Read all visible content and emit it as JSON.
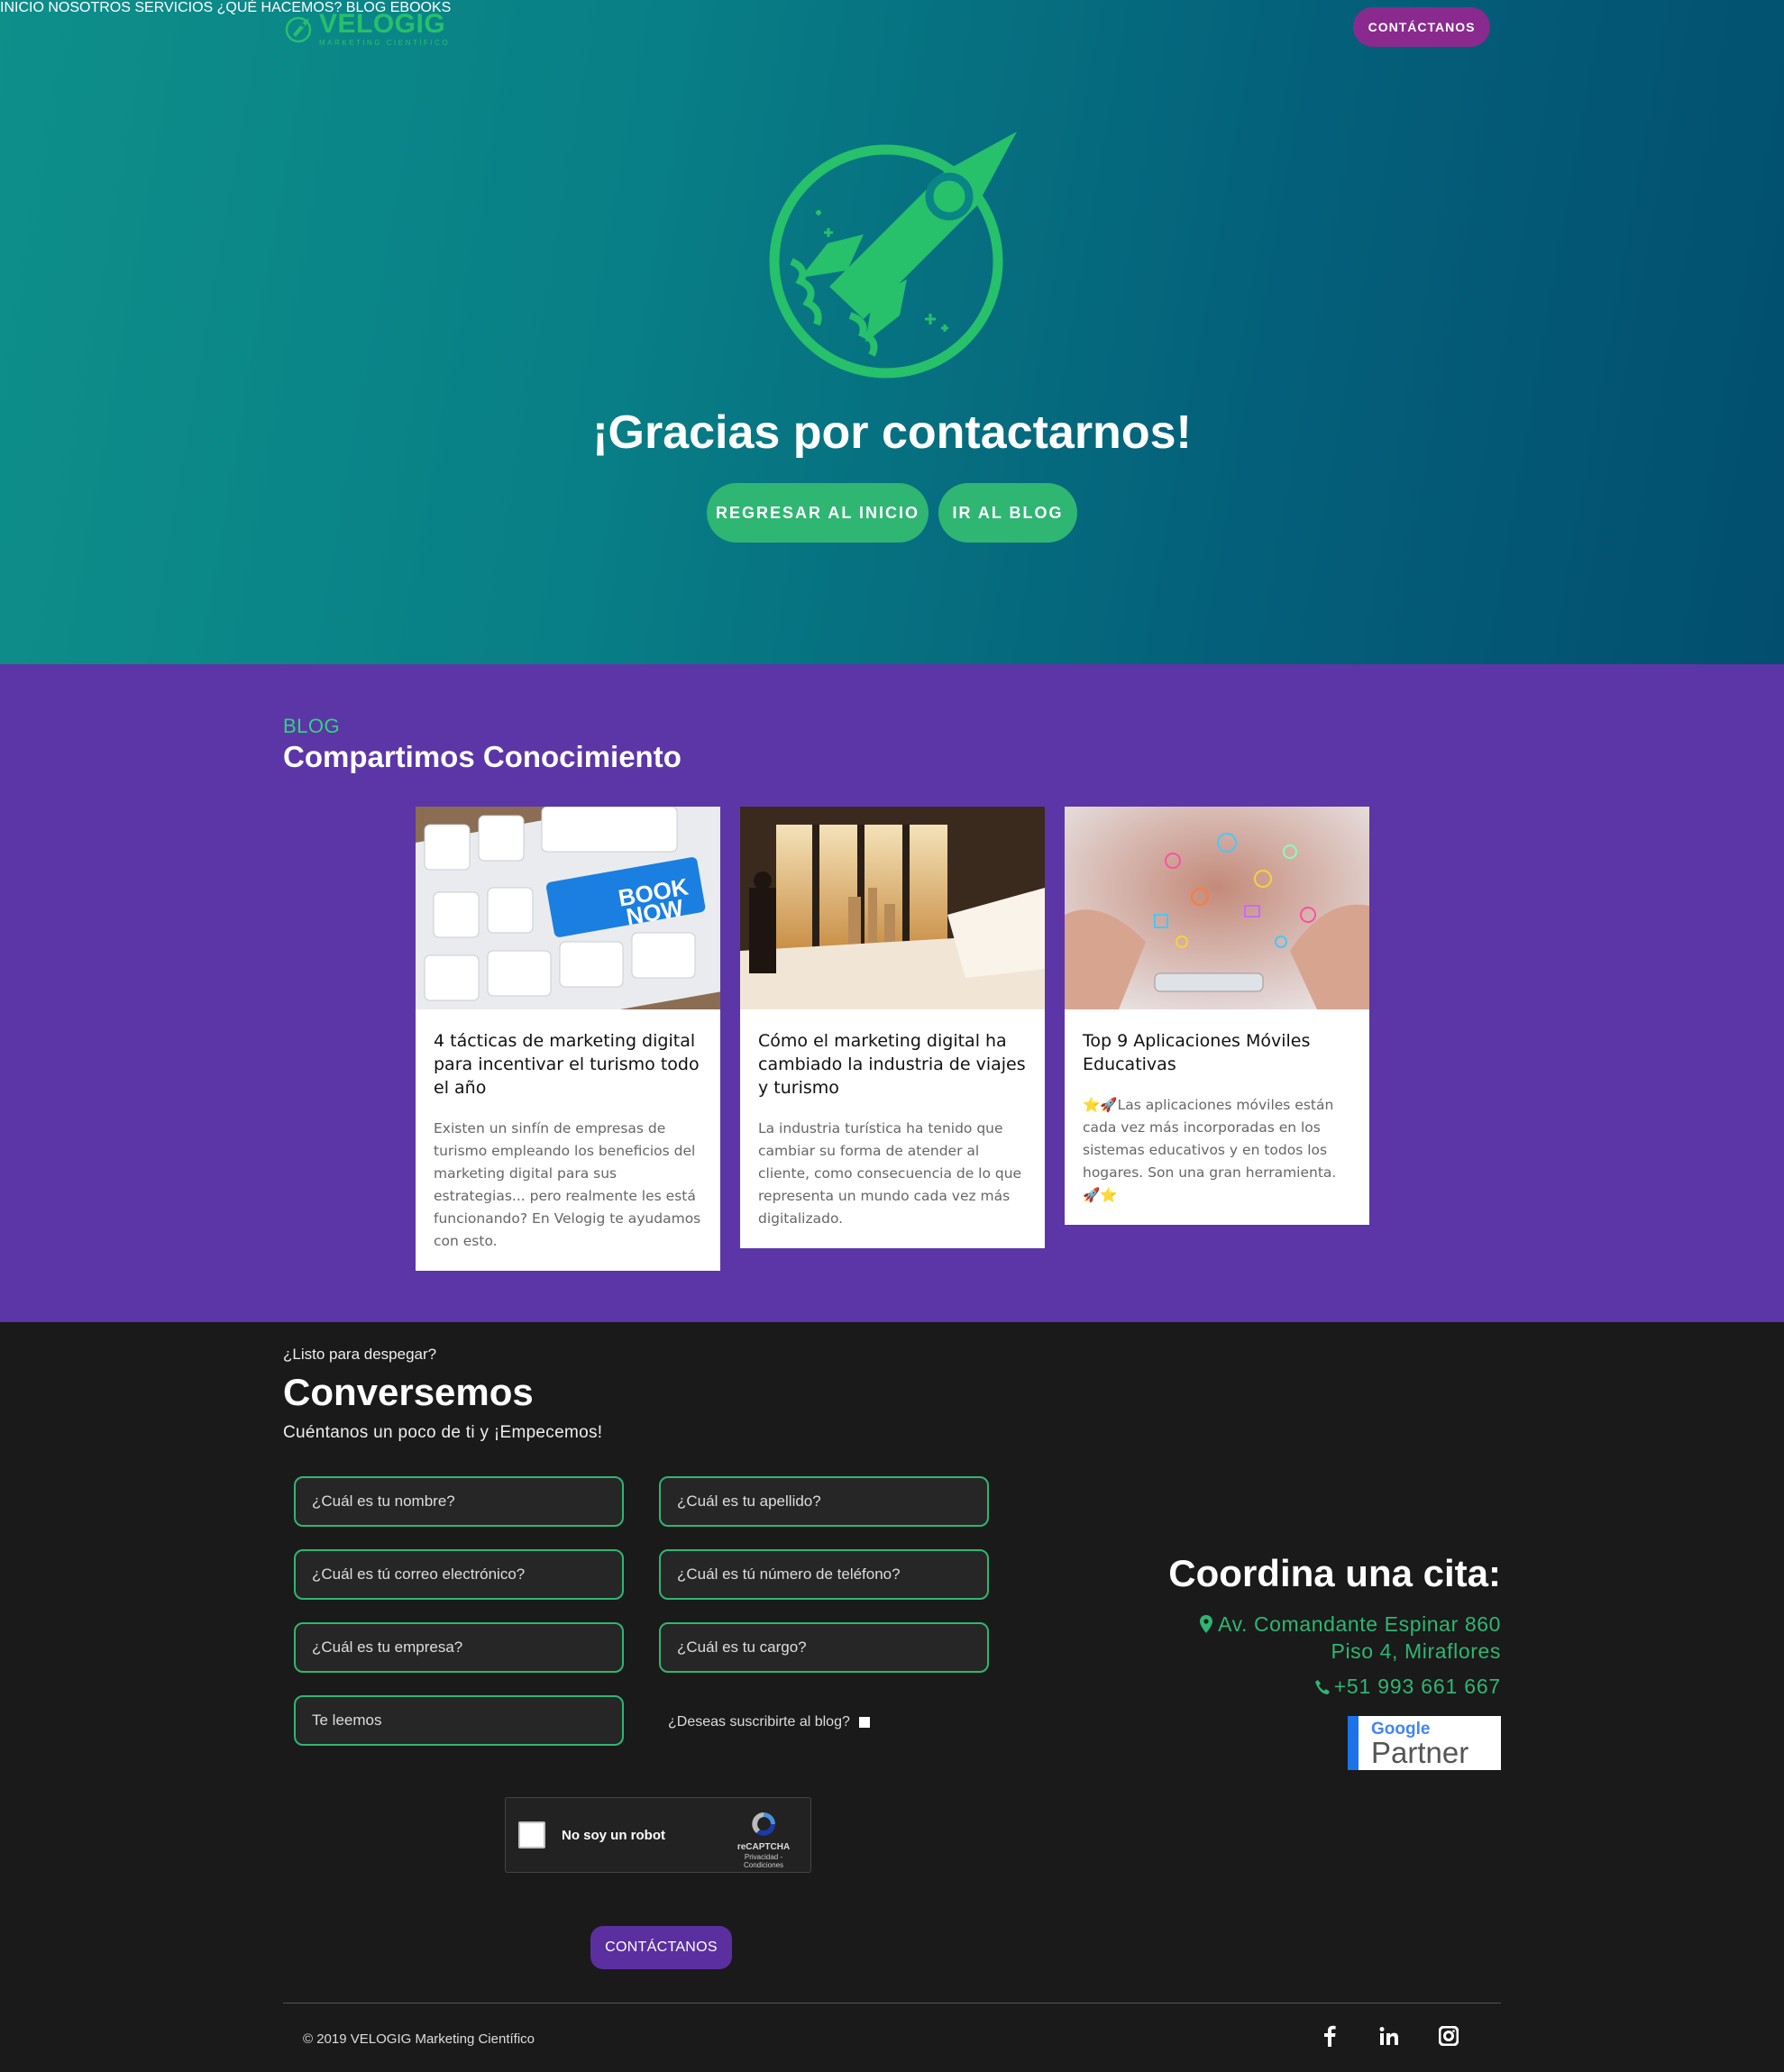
{
  "brand": {
    "name": "VELOGIG",
    "tagline": "MARKETING CIENTÍFICO",
    "color": "#27c06b"
  },
  "nav": {
    "items": [
      "INICIO",
      "NOSOTROS",
      "SERVICIOS",
      "¿QUÉ HACEMOS?",
      "BLOG",
      "EBOOKS"
    ],
    "cta": "CONTÁCTANOS"
  },
  "hero": {
    "icon": "rocket-icon",
    "title": "¡Gracias por contactarnos!",
    "buttons": [
      "REGRESAR AL INICIO",
      "IR AL BLOG"
    ]
  },
  "blog": {
    "kicker": "BLOG",
    "title": "Compartimos Conocimiento",
    "posts": [
      {
        "title": "4 tácticas de marketing digital para incentivar el turismo todo el año",
        "excerpt": "Existen un sinfín de empresas de turismo empleando los beneficios del marketing digital para sus estrategias... pero realmente les está funcionando? En Velogig te ayudamos con esto.",
        "image": "keyboard-book-now-image"
      },
      {
        "title": "Cómo el marketing digital ha cambiado la industria de viajes y turismo",
        "excerpt": "La industria turística ha tenido que cambiar su forma de atender al cliente, como consecuencia de lo que representa un mundo cada vez más digitalizado.",
        "image": "hotel-room-window-image"
      },
      {
        "title": "Top 9 Aplicaciones Móviles Educativas",
        "excerpt": "⭐🚀Las aplicaciones móviles están cada vez más incorporadas en los sistemas educativos y en todos los hogares. Son una gran herramienta. 🚀⭐",
        "image": "mobile-apps-icons-image"
      }
    ]
  },
  "contact": {
    "kicker": "¿Listo para despegar?",
    "title": "Conversemos",
    "subtitle": "Cuéntanos un poco de ti y ¡Empecemos!",
    "fields": {
      "first_name": "¿Cuál es tu nombre?",
      "last_name": "¿Cuál es tu apellido?",
      "email": "¿Cuál es tú correo electrónico?",
      "phone": "¿Cuál es tú número de teléfono?",
      "company": "¿Cuál es tu empresa?",
      "position": "¿Cuál es tu cargo?",
      "message": "Te leemos"
    },
    "subscribe_label": "¿Deseas suscribirte al blog?",
    "captcha": {
      "label": "No soy un robot",
      "brand": "reCAPTCHA",
      "links": "Privacidad - Condiciones"
    },
    "submit": "CONTÁCTANOS"
  },
  "appointment": {
    "title": "Coordina una cita:",
    "address_line1": "Av. Comandante Espinar 860",
    "address_line2": "Piso 4, Miraflores",
    "phone": "+51 993 661 667",
    "badge": {
      "google": "Google",
      "partner": "Partner"
    }
  },
  "footer": {
    "copyright": "© 2019 VELOGIG Marketing Científico",
    "social": [
      "facebook-icon",
      "linkedin-icon",
      "instagram-icon"
    ]
  }
}
